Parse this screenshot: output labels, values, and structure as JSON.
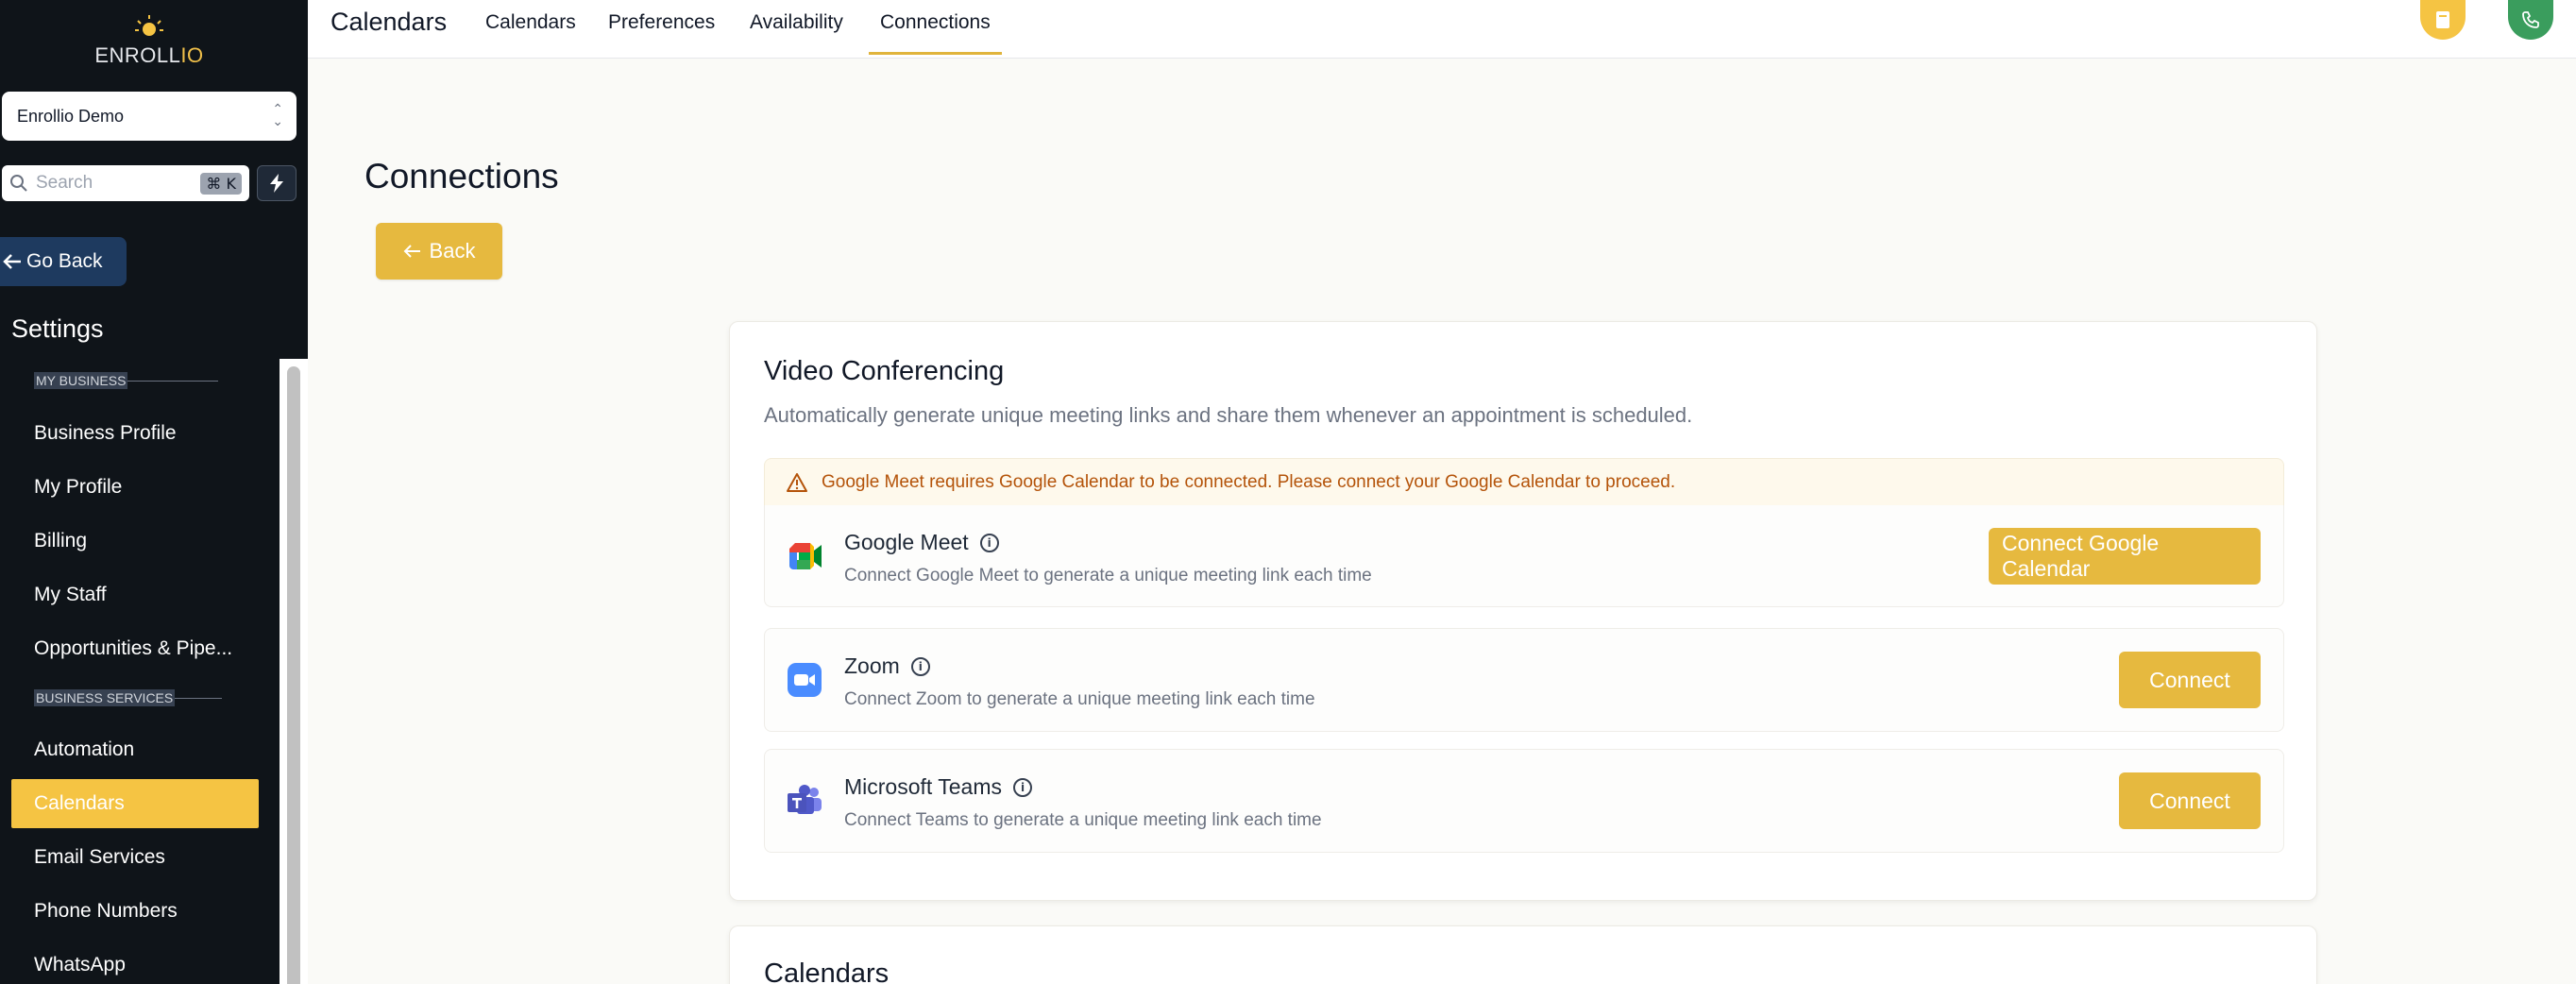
{
  "app": {
    "logo_text_main": "ENROLL",
    "logo_text_accent": "IO"
  },
  "sidebar": {
    "account_name": "Enrollio Demo",
    "search_placeholder": "Search",
    "search_shortcut": "⌘ K",
    "go_back_label": "Go Back",
    "settings_title": "Settings",
    "sections": [
      {
        "label": "MY BUSINESS",
        "items": [
          "Business Profile",
          "My Profile",
          "Billing",
          "My Staff",
          "Opportunities & Pipe..."
        ]
      },
      {
        "label": "BUSINESS SERVICES",
        "items": [
          "Automation",
          "Calendars",
          "Email Services",
          "Phone Numbers",
          "WhatsApp"
        ]
      }
    ],
    "active_item": "Calendars"
  },
  "topbar": {
    "title": "Calendars",
    "tabs": [
      "Calendars",
      "Preferences",
      "Availability",
      "Connections"
    ],
    "active_tab": "Connections"
  },
  "main": {
    "page_title": "Connections",
    "back_label": "Back",
    "video": {
      "title": "Video Conferencing",
      "description": "Automatically generate unique meeting links and share them whenever an appointment is scheduled.",
      "warning": "Google Meet requires Google Calendar to be connected. Please connect your Google Calendar to proceed.",
      "providers": [
        {
          "name": "Google Meet",
          "description": "Connect Google Meet to generate a unique meeting link each time",
          "button": "Connect Google Calendar"
        },
        {
          "name": "Zoom",
          "description": "Connect Zoom to generate a unique meeting link each time",
          "button": "Connect"
        },
        {
          "name": "Microsoft Teams",
          "description": "Connect Teams to generate a unique meeting link each time",
          "button": "Connect"
        }
      ]
    },
    "calendars_title": "Calendars"
  },
  "colors": {
    "accent": "#e6b93f",
    "sidebar_bg": "#0f1419",
    "active_nav": "#f5c443",
    "go_back_bg": "#1e3a5f",
    "warning_text": "#b45309",
    "phone_green": "#3a9d5d"
  }
}
